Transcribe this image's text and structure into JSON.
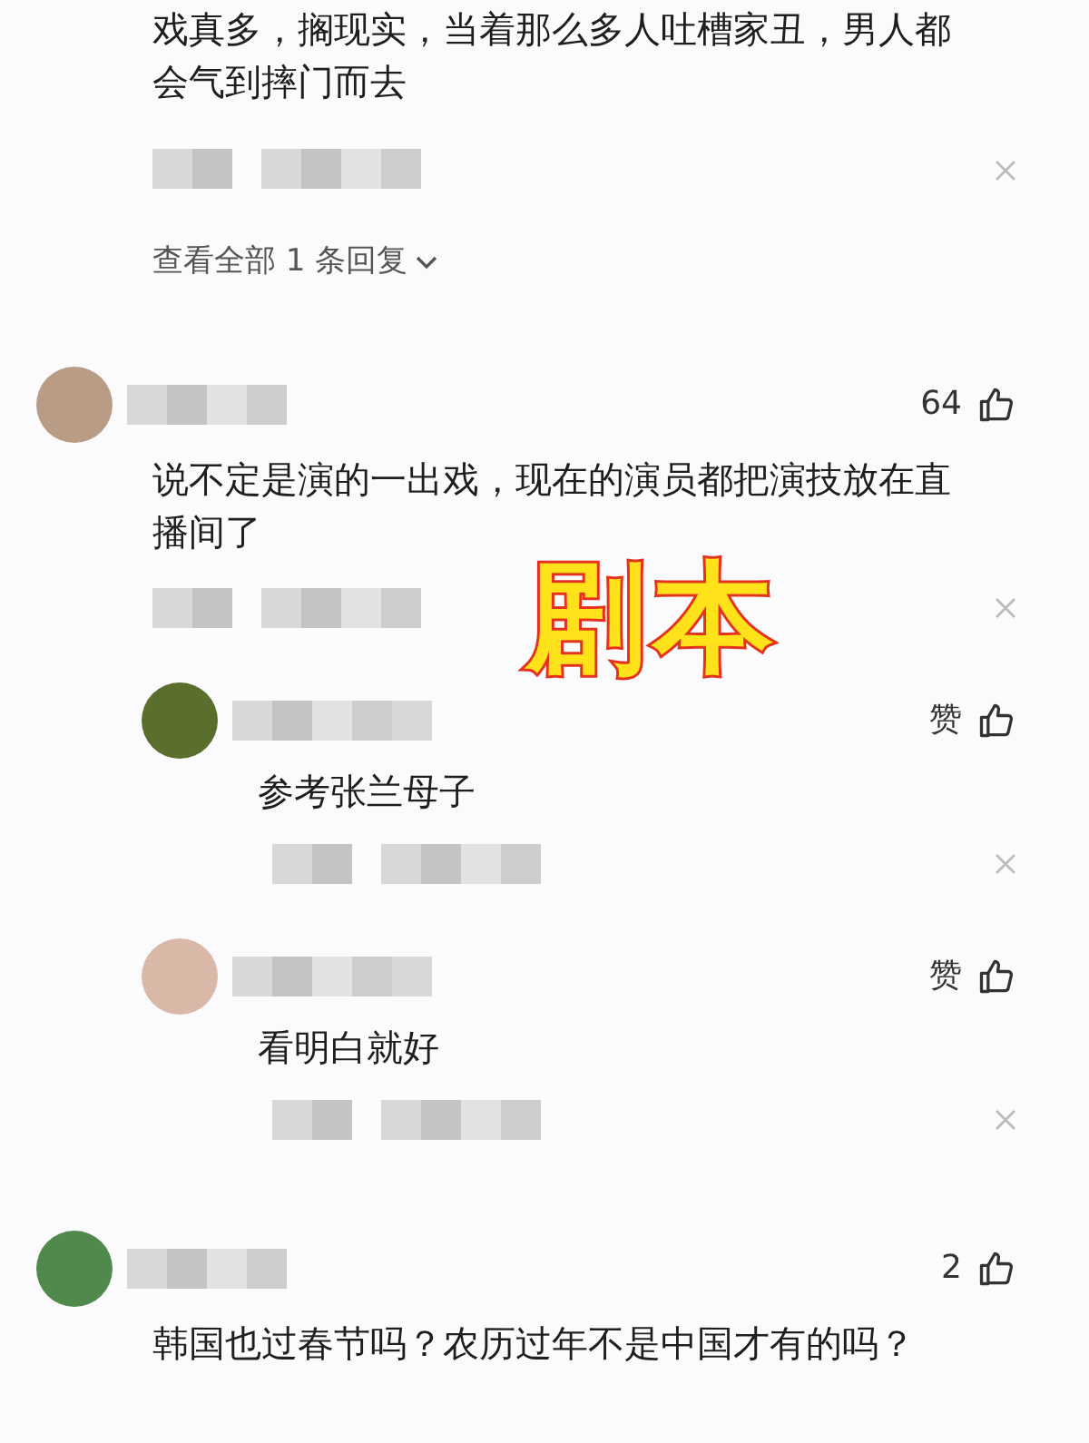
{
  "comments": [
    {
      "kind": "partial",
      "text": "戏真多，搁现实，当着那么多人吐槽家丑，男人都会气到摔门而去",
      "more_replies": "查看全部 1 条回复"
    },
    {
      "kind": "top",
      "likes": "64",
      "text": "说不定是演的一出戏，现在的演员都把演技放在直播间了",
      "replies": [
        {
          "likes": "赞",
          "text": "参考张兰母子"
        },
        {
          "likes": "赞",
          "text": "看明白就好"
        }
      ]
    },
    {
      "kind": "top",
      "likes": "2",
      "text": "韩国也过春节吗？农历过年不是中国才有的吗？"
    }
  ],
  "caption": "剧本"
}
